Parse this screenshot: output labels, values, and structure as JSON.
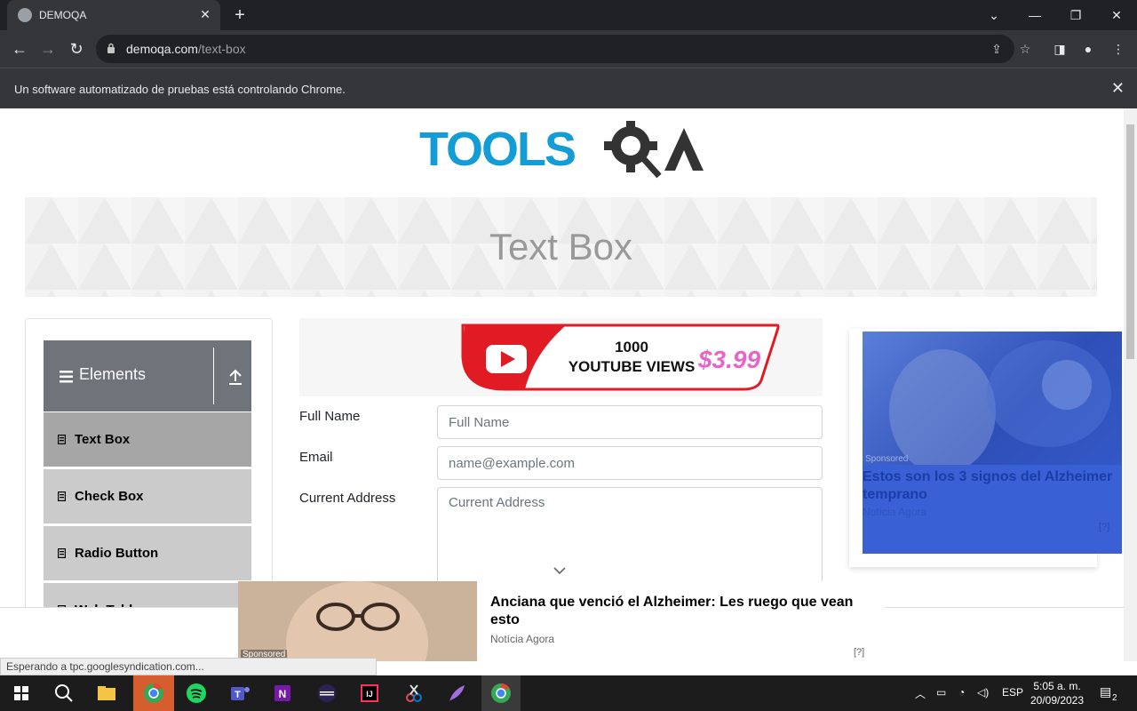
{
  "browser": {
    "tab_title": "DEMOQA",
    "url_host": "demoqa.com",
    "url_path": "/text-box",
    "infobar_message": "Un software automatizado de pruebas está controlando Chrome."
  },
  "page": {
    "logo_text": "TOOLSQA",
    "banner_title": "Text Box"
  },
  "sidebar": {
    "group_title": "Elements",
    "items": [
      {
        "label": "Text Box",
        "active": true
      },
      {
        "label": "Check Box",
        "active": false
      },
      {
        "label": "Radio Button",
        "active": false
      },
      {
        "label": "Web Tables",
        "active": false
      }
    ]
  },
  "ads": {
    "youtube": {
      "line1": "1000",
      "line2": "YOUTUBE VIEWS",
      "price": "$3.99"
    },
    "right": {
      "sponsored": "Sponsored",
      "headline": "Estos son los 3 signos del Alzheimer temprano",
      "source": "Notícia Agora",
      "marker": "[?]"
    },
    "bottom": {
      "sponsored": "Sponsored",
      "headline": "Anciana que venció el Alzheimer: Les ruego que vean esto",
      "source": "Notícia Agora",
      "marker": "[?]"
    }
  },
  "form": {
    "full_name": {
      "label": "Full Name",
      "placeholder": "Full Name",
      "value": ""
    },
    "email": {
      "label": "Email",
      "placeholder": "name@example.com",
      "value": ""
    },
    "current_address": {
      "label": "Current Address",
      "placeholder": "Current Address",
      "value": ""
    }
  },
  "status_text": "Esperando a tpc.googlesyndication.com...",
  "taskbar": {
    "language": "ESP",
    "time": "5:05 a. m.",
    "date": "20/09/2023",
    "notifications": "2"
  }
}
